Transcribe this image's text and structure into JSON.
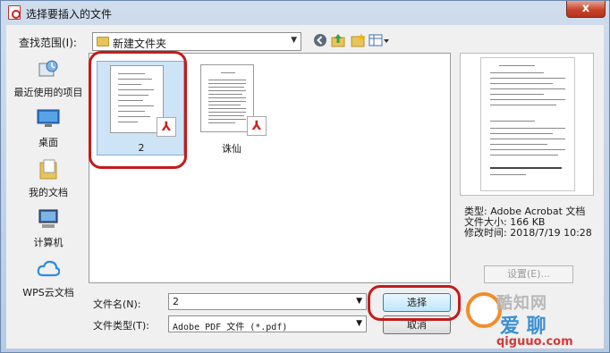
{
  "window": {
    "title": "选择要插入的文件",
    "close_label": "x"
  },
  "lookin": {
    "label": "查找范围(I):",
    "value": "新建文件夹"
  },
  "places": [
    {
      "label": "最近使用的项目",
      "icon": "recent-items-icon"
    },
    {
      "label": "桌面",
      "icon": "desktop-icon"
    },
    {
      "label": "我的文档",
      "icon": "my-documents-icon"
    },
    {
      "label": "计算机",
      "icon": "computer-icon"
    },
    {
      "label": "WPS云文档",
      "icon": "cloud-icon"
    }
  ],
  "files": [
    {
      "name": "2",
      "selected": true
    },
    {
      "name": "诛仙",
      "selected": false
    }
  ],
  "info": {
    "type": "类型: Adobe Acrobat 文档",
    "size": "文件大小: 166 KB",
    "modified": "修改时间: 2018/7/19 10:28"
  },
  "settings_label": "设置(E)...",
  "filename": {
    "label": "文件名(N):",
    "value": "2"
  },
  "filetype": {
    "label": "文件类型(T):",
    "value": "Adobe PDF 文件 (*.pdf)"
  },
  "buttons": {
    "select": "选择",
    "cancel": "取消"
  },
  "watermark": {
    "line1": "酷知网",
    "line2": "爱 聊",
    "line3": "qiguuo.com"
  },
  "colors": {
    "highlight": "#c41b1b",
    "selection": "#cde4f7",
    "titlebar": "#b7cbe3"
  }
}
